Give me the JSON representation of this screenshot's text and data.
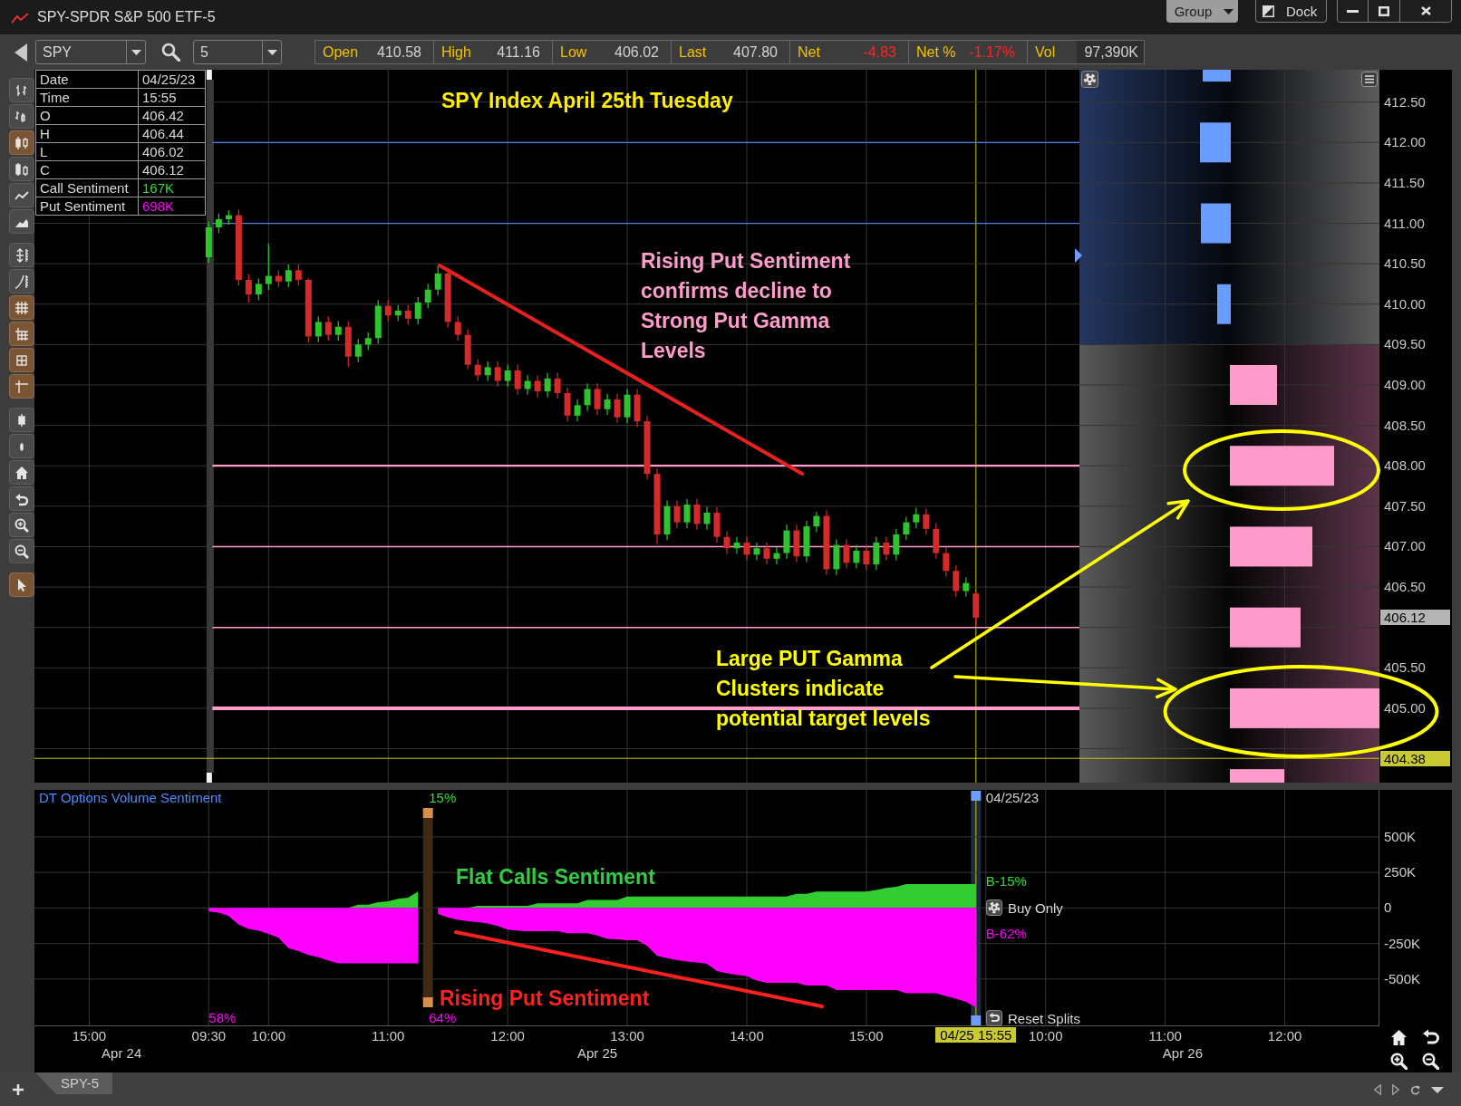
{
  "window": {
    "title": "SPY-SPDR S&P 500 ETF-5",
    "group_button": "Group",
    "dock_button": "Dock"
  },
  "toolbar": {
    "symbol": "SPY",
    "interval": "5",
    "quotes": [
      {
        "label": "Open",
        "value": "410.58",
        "kind": "plain"
      },
      {
        "label": "High",
        "value": "411.16",
        "kind": "plain"
      },
      {
        "label": "Low",
        "value": "406.02",
        "kind": "plain"
      },
      {
        "label": "Last",
        "value": "407.80",
        "kind": "plain"
      },
      {
        "label": "Net",
        "value": "-4.83",
        "kind": "negative"
      },
      {
        "label": "Net %",
        "value": "-1.17%",
        "kind": "negative"
      },
      {
        "label": "Vol",
        "value": "97,390K",
        "kind": "total"
      }
    ]
  },
  "left_toolbar": [
    {
      "tools": [
        {
          "kind": "bar",
          "selected": false
        },
        {
          "kind": "hlc",
          "selected": false
        },
        {
          "kind": "candle",
          "selected": true
        },
        {
          "kind": "hollow-candle",
          "selected": false
        },
        {
          "kind": "line",
          "selected": false
        },
        {
          "kind": "area",
          "selected": false
        }
      ]
    },
    {
      "tools": [
        {
          "kind": "autoscale",
          "selected": false
        },
        {
          "kind": "log-scale",
          "selected": false
        },
        {
          "kind": "grid",
          "selected": true
        },
        {
          "kind": "axis-grid",
          "selected": true
        },
        {
          "kind": "data-box",
          "selected": true
        },
        {
          "kind": "crosshair",
          "selected": true
        }
      ]
    },
    {
      "tools": [
        {
          "kind": "wide-bars",
          "selected": false
        },
        {
          "kind": "narrow-bars",
          "selected": false
        },
        {
          "kind": "home",
          "selected": false
        },
        {
          "kind": "undo",
          "selected": false
        },
        {
          "kind": "zoom-in",
          "selected": false
        },
        {
          "kind": "zoom-out",
          "selected": false
        }
      ]
    },
    {
      "tools": [
        {
          "kind": "pointer",
          "selected": true
        }
      ]
    }
  ],
  "data_box": [
    {
      "label": "Date",
      "value": "04/25/23",
      "kind": "plain"
    },
    {
      "label": "Time",
      "value": "15:55",
      "kind": "plain"
    },
    {
      "label": "O",
      "value": "406.42",
      "kind": "plain"
    },
    {
      "label": "H",
      "value": "406.44",
      "kind": "plain"
    },
    {
      "label": "L",
      "value": "406.02",
      "kind": "plain"
    },
    {
      "label": "C",
      "value": "406.12",
      "kind": "plain"
    },
    {
      "label": "Call Sentiment",
      "value": "167K",
      "kind": "call"
    },
    {
      "label": "Put Sentiment",
      "value": "698K",
      "kind": "put"
    }
  ],
  "price_chart": {
    "chart_data": {
      "type": "candlestick",
      "categories": [
        null,
        null,
        null,
        null,
        null,
        null,
        null,
        null,
        null,
        null,
        null,
        null,
        null,
        null,
        null,
        null,
        null,
        null,
        null,
        null,
        null,
        null,
        null,
        null,
        null,
        null,
        null,
        null,
        null,
        null,
        null,
        null,
        null,
        null,
        null,
        null,
        null,
        null,
        null,
        null,
        null,
        null,
        null,
        null,
        null,
        null,
        null,
        null,
        null,
        null,
        null,
        null,
        null,
        null,
        null,
        null,
        null,
        null,
        null,
        null,
        null,
        null,
        null,
        null,
        null,
        null,
        null,
        null,
        null,
        null,
        null,
        null,
        null,
        null,
        null,
        null,
        null,
        null,
        null,
        null,
        null,
        null,
        null,
        null,
        null,
        null,
        null,
        null,
        null,
        null,
        null,
        null,
        null,
        null,
        null,
        null,
        null,
        null,
        null,
        null,
        null,
        null,
        null,
        null,
        null,
        null,
        null,
        null,
        null,
        null,
        null,
        null,
        null,
        null,
        null,
        null,
        null,
        null,
        null,
        null,
        null,
        null,
        null,
        null,
        null,
        null,
        null,
        null,
        null,
        null,
        null,
        null,
        null,
        null,
        null
      ],
      "ohlc": [
        null,
        null,
        null,
        null,
        null,
        null,
        null,
        null,
        null,
        null,
        null,
        null,
        null,
        null,
        null,
        null,
        null,
        [
          410.58,
          411.02,
          410.51,
          410.95
        ],
        [
          410.95,
          411.12,
          410.88,
          411.05
        ],
        [
          411.05,
          411.16,
          410.98,
          411.1
        ],
        [
          411.1,
          411.17,
          410.23,
          410.3
        ],
        [
          410.3,
          410.37,
          410.02,
          410.12
        ],
        [
          410.12,
          410.32,
          410.05,
          410.25
        ],
        [
          410.25,
          410.75,
          410.18,
          410.35
        ],
        [
          410.35,
          410.42,
          410.21,
          410.28
        ],
        [
          410.28,
          410.49,
          410.21,
          410.42
        ],
        [
          410.42,
          410.49,
          410.23,
          410.3
        ],
        [
          410.3,
          410.32,
          409.52,
          409.6
        ],
        [
          409.6,
          409.85,
          409.53,
          409.78
        ],
        [
          409.78,
          409.85,
          409.55,
          409.62
        ],
        [
          409.62,
          409.79,
          409.55,
          409.72
        ],
        [
          409.72,
          409.79,
          409.22,
          409.35
        ],
        [
          409.35,
          409.57,
          409.28,
          409.5
        ],
        [
          409.5,
          409.65,
          409.43,
          409.58
        ],
        [
          409.58,
          410.05,
          409.51,
          409.98
        ],
        [
          409.98,
          410.05,
          409.79,
          409.86
        ],
        [
          409.86,
          409.99,
          409.79,
          409.92
        ],
        [
          409.92,
          409.99,
          409.75,
          409.82
        ],
        [
          409.82,
          410.09,
          409.75,
          410.02
        ],
        [
          410.02,
          410.25,
          409.95,
          410.18
        ],
        [
          410.18,
          410.47,
          410.11,
          410.38
        ],
        [
          410.38,
          410.45,
          409.71,
          409.78
        ],
        [
          409.78,
          409.85,
          409.55,
          409.62
        ],
        [
          409.62,
          409.69,
          409.2,
          409.25
        ],
        [
          409.25,
          409.32,
          409.05,
          409.12
        ],
        [
          409.12,
          409.29,
          409.05,
          409.22
        ],
        [
          409.22,
          409.29,
          408.98,
          409.05
        ],
        [
          409.05,
          409.25,
          408.98,
          409.18
        ],
        [
          409.18,
          409.25,
          408.88,
          408.95
        ],
        [
          408.95,
          409.12,
          408.88,
          409.05
        ],
        [
          409.05,
          409.12,
          408.85,
          408.92
        ],
        [
          408.92,
          409.15,
          408.85,
          409.08
        ],
        [
          409.08,
          409.15,
          408.83,
          408.9
        ],
        [
          408.9,
          408.97,
          408.55,
          408.62
        ],
        [
          408.62,
          408.82,
          408.55,
          408.75
        ],
        [
          408.75,
          409.02,
          408.68,
          408.95
        ],
        [
          408.95,
          409.02,
          408.63,
          408.7
        ],
        [
          408.7,
          408.89,
          408.63,
          408.82
        ],
        [
          408.82,
          408.89,
          408.53,
          408.6
        ],
        [
          408.6,
          408.95,
          408.53,
          408.88
        ],
        [
          408.88,
          408.95,
          408.48,
          408.55
        ],
        [
          408.55,
          408.62,
          407.83,
          407.9
        ],
        [
          407.9,
          407.97,
          407.03,
          407.15
        ],
        [
          407.15,
          407.57,
          407.08,
          407.5
        ],
        [
          407.5,
          407.57,
          407.23,
          407.3
        ],
        [
          407.3,
          407.59,
          407.23,
          407.52
        ],
        [
          407.52,
          407.59,
          407.21,
          407.28
        ],
        [
          407.28,
          407.49,
          407.21,
          407.42
        ],
        [
          407.42,
          407.49,
          407.05,
          407.12
        ],
        [
          407.12,
          407.19,
          406.91,
          406.98
        ],
        [
          406.98,
          407.12,
          406.91,
          407.05
        ],
        [
          407.05,
          407.12,
          406.83,
          406.9
        ],
        [
          406.9,
          407.05,
          406.83,
          406.98
        ],
        [
          406.98,
          407.05,
          406.78,
          406.85
        ],
        [
          406.85,
          406.99,
          406.78,
          406.92
        ],
        [
          406.92,
          407.27,
          406.85,
          407.2
        ],
        [
          407.2,
          407.27,
          406.81,
          406.88
        ],
        [
          406.88,
          407.32,
          406.81,
          407.25
        ],
        [
          407.25,
          407.43,
          407.18,
          407.38
        ],
        [
          407.38,
          407.45,
          406.65,
          406.72
        ],
        [
          406.72,
          407.09,
          406.65,
          407.02
        ],
        [
          407.02,
          407.09,
          406.73,
          406.8
        ],
        [
          406.8,
          407.02,
          406.73,
          406.95
        ],
        [
          406.95,
          407.02,
          406.71,
          406.78
        ],
        [
          406.78,
          407.12,
          406.71,
          407.05
        ],
        [
          407.05,
          407.12,
          406.83,
          406.9
        ],
        [
          406.9,
          407.22,
          406.83,
          407.15
        ],
        [
          407.15,
          407.37,
          407.08,
          407.3
        ],
        [
          407.3,
          407.48,
          407.23,
          407.4
        ],
        [
          407.4,
          407.47,
          407.15,
          407.22
        ],
        [
          407.22,
          407.29,
          406.85,
          406.92
        ],
        [
          406.92,
          406.99,
          406.63,
          406.7
        ],
        [
          406.7,
          406.77,
          406.38,
          406.45
        ],
        [
          406.45,
          406.62,
          406.38,
          406.55
        ],
        [
          406.42,
          406.44,
          406.02,
          406.12
        ],
        null,
        null,
        null,
        null,
        null,
        null,
        null,
        null,
        null,
        null,
        null,
        null,
        null,
        null,
        null,
        null,
        null,
        null,
        null,
        null,
        null,
        null,
        null,
        null,
        null,
        null,
        null,
        null,
        null,
        null,
        null,
        null,
        null,
        null,
        null,
        null,
        null,
        null,
        null,
        null
      ],
      "ylim": [
        404.08,
        412.9
      ],
      "yticks": [
        {
          "value": 412.5,
          "label": "412.50"
        },
        {
          "value": 412,
          "label": "412.00"
        },
        {
          "value": 411.5,
          "label": "411.50"
        },
        {
          "value": 411,
          "label": "411.00"
        },
        {
          "value": 410.5,
          "label": "410.50"
        },
        {
          "value": 410,
          "label": "410.00"
        },
        {
          "value": 409.5,
          "label": "409.50"
        },
        {
          "value": 409,
          "label": "409.00"
        },
        {
          "value": 408.5,
          "label": "408.50"
        },
        {
          "value": 408,
          "label": "408.00"
        },
        {
          "value": 407.5,
          "label": "407.50"
        },
        {
          "value": 407,
          "label": "407.00"
        },
        {
          "value": 406.5,
          "label": "406.50"
        },
        {
          "value": 405.5,
          "label": "405.50"
        },
        {
          "value": 405,
          "label": "405.00"
        }
      ],
      "grid": true,
      "ref_lines": [
        {
          "axis": "y",
          "value": 412,
          "color": "#4f7fe8"
        },
        {
          "axis": "y",
          "value": 411,
          "color": "#4f7fe8"
        },
        {
          "axis": "y",
          "value": 408,
          "color": "#ff9ccc"
        },
        {
          "axis": "y",
          "value": 407,
          "color": "#ff9ccc"
        },
        {
          "axis": "y",
          "value": 406,
          "color": "#ff9ccc"
        },
        {
          "axis": "y",
          "value": 405,
          "color": "#ff9ccc"
        },
        {
          "axis": "y",
          "value": 404.38,
          "color": "#c8c800",
          "label": "404.38"
        }
      ],
      "annotations": [
        "406.12"
      ]
    },
    "annotations": [
      {
        "kind": "title",
        "text": "SPY Index April 25th Tuesday"
      },
      {
        "kind": "put-note",
        "text": "Rising Put Sentiment\nconfirms decline to\nStrong Put Gamma\nLevels"
      },
      {
        "kind": "gamma-note",
        "text": "Large PUT Gamma\nClusters indicate\npotential target levels"
      }
    ]
  },
  "sentiment_panel": {
    "chart_data": {
      "type": "area",
      "title": "DT Options Volume Sentiment",
      "categories": [
        null,
        null,
        null,
        null,
        null,
        "15:00",
        null,
        null,
        null,
        null,
        null,
        null,
        null,
        null,
        null,
        null,
        null,
        "09:30",
        null,
        null,
        null,
        null,
        null,
        "10:00",
        null,
        null,
        null,
        null,
        null,
        null,
        null,
        null,
        null,
        null,
        null,
        "11:00",
        null,
        null,
        null,
        null,
        null,
        null,
        null,
        null,
        null,
        null,
        null,
        "12:00",
        null,
        null,
        null,
        null,
        null,
        null,
        null,
        null,
        null,
        null,
        null,
        "13:00",
        null,
        null,
        null,
        null,
        null,
        null,
        null,
        null,
        null,
        null,
        null,
        "14:00",
        null,
        null,
        null,
        null,
        null,
        null,
        null,
        null,
        null,
        null,
        null,
        "15:00",
        null,
        null,
        null,
        null,
        null,
        null,
        null,
        null,
        null,
        null,
        null,
        null,
        null,
        null,
        null,
        null,
        null,
        "10:00",
        null,
        null,
        null,
        null,
        null,
        null,
        null,
        null,
        null,
        null,
        null,
        "11:00",
        null,
        null,
        null,
        null,
        null,
        null,
        null,
        null,
        null,
        null,
        null,
        "12:00",
        null,
        null,
        null,
        null,
        null,
        null,
        null,
        null,
        null
      ],
      "series": [
        {
          "color": "#33cc33",
          "values": [
            null,
            null,
            null,
            null,
            null,
            null,
            null,
            null,
            null,
            null,
            null,
            null,
            null,
            null,
            null,
            null,
            null,
            0,
            0,
            0,
            0,
            0,
            0,
            0,
            0,
            0,
            0,
            0,
            0,
            0,
            0,
            0,
            23,
            23,
            40,
            47,
            65,
            73,
            115,
            null,
            0,
            0,
            0,
            0,
            15,
            15,
            15,
            15,
            15,
            15,
            33,
            33,
            33,
            33,
            33,
            57,
            57,
            57,
            57,
            80,
            80,
            80,
            80,
            80,
            80,
            80,
            80,
            80,
            80,
            80,
            80,
            80,
            80,
            80,
            80,
            80,
            99,
            99,
            115,
            115,
            115,
            115,
            115,
            115,
            127,
            140,
            148,
            167,
            167,
            167,
            167,
            167,
            167,
            167,
            167,
            null,
            null,
            null,
            null,
            null,
            null,
            null,
            null,
            null,
            null,
            null,
            null,
            null,
            null,
            null,
            null,
            null,
            null,
            null,
            null,
            null,
            null,
            null,
            null,
            null,
            null,
            null,
            null,
            null,
            null,
            null,
            null,
            null,
            null,
            null,
            null,
            null,
            null,
            null,
            null
          ]
        },
        {
          "color": "#ff00ff",
          "values": [
            null,
            null,
            null,
            null,
            null,
            null,
            null,
            null,
            null,
            null,
            null,
            null,
            null,
            null,
            null,
            null,
            null,
            -25,
            -33,
            -57,
            -117,
            -147,
            -160,
            -183,
            -210,
            -283,
            -303,
            -330,
            -346,
            -370,
            -390,
            -390,
            -390,
            -390,
            -390,
            -390,
            -390,
            -390,
            -390,
            null,
            -43,
            -67,
            -83,
            -93,
            -100,
            -110,
            -127,
            -153,
            -160,
            -163,
            -163,
            -163,
            -163,
            -177,
            -177,
            -177,
            -193,
            -217,
            -220,
            -227,
            -227,
            -267,
            -337,
            -353,
            -367,
            -377,
            -383,
            -393,
            -443,
            -460,
            -470,
            -480,
            -511,
            -527,
            -527,
            -527,
            -527,
            -545,
            -545,
            -545,
            -577,
            -577,
            -577,
            -577,
            -577,
            -577,
            -577,
            -600,
            -600,
            -600,
            -600,
            -620,
            -637,
            -660,
            -698,
            null,
            null,
            null,
            null,
            null,
            null,
            null,
            null,
            null,
            null,
            null,
            null,
            null,
            null,
            null,
            null,
            null,
            null,
            null,
            null,
            null,
            null,
            null,
            null,
            null,
            null,
            null,
            null,
            null,
            null,
            null,
            null,
            null,
            null,
            null,
            null,
            null,
            null,
            null,
            null
          ]
        }
      ],
      "ylim": [
        -832,
        830
      ],
      "yticks": [
        {
          "value": 500,
          "label": "500K"
        },
        {
          "value": 250,
          "label": "250K"
        },
        {
          "value": 0,
          "label": "0"
        },
        {
          "value": -250,
          "label": "-250K"
        },
        {
          "value": -500,
          "label": "-500K"
        }
      ],
      "grid": true
    },
    "date_labels": [
      "Apr 24",
      "Apr 25",
      "Apr 26"
    ],
    "split": {
      "call_percent": "15%",
      "put_percent": "64%"
    },
    "start_put_percent": "58%",
    "cursor": {
      "date": "04/25/23",
      "time": "04/25 15:55",
      "call_reading": "B-15%",
      "put_reading": "B-62%"
    },
    "buttons": [
      {
        "kind": "mode",
        "label": "Buy Only"
      },
      {
        "kind": "reset",
        "label": "Reset Splits"
      }
    ],
    "annotations": [
      {
        "kind": "calls-note",
        "text": "Flat Calls Sentiment"
      },
      {
        "kind": "puts-note",
        "text": "Rising Put Sentiment"
      }
    ]
  },
  "tabs": [
    {
      "label": "SPY-5",
      "selected": true
    }
  ]
}
